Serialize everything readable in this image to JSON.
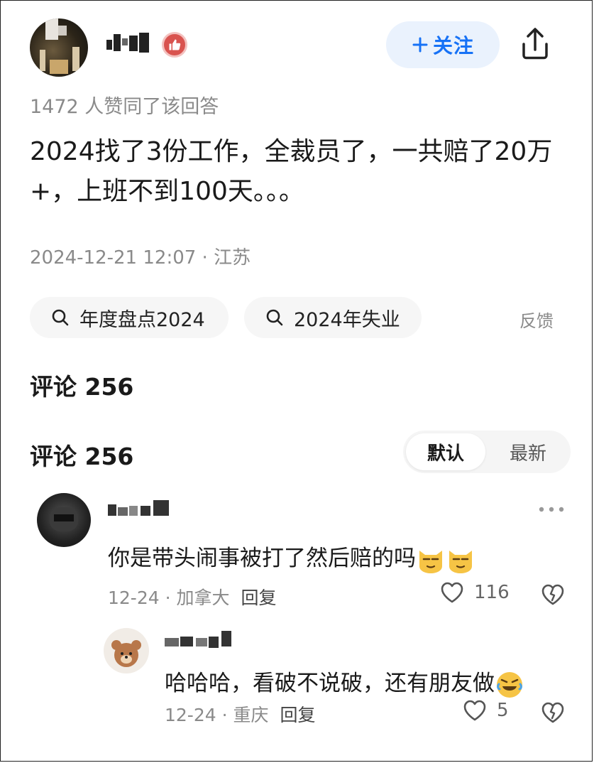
{
  "header": {
    "follow_label": "关注",
    "follow_icon": "plus-icon",
    "share_icon": "share-icon",
    "badge_icon": "thumbs-up-icon"
  },
  "answer": {
    "likes_text": "1472 人赞同了该回答",
    "content": "2024找了3份工作，全裁员了，一共赔了20万+，上班不到100天。。。",
    "meta": "2024-12-21 12:07 · 江苏"
  },
  "tags": [
    {
      "label": "年度盘点2024",
      "icon": "search-icon"
    },
    {
      "label": "2024年失业",
      "icon": "search-icon"
    }
  ],
  "feedback_label": "反馈",
  "comments": {
    "title": "评论 256",
    "sort_options": [
      "默认",
      "最新"
    ],
    "sort_selected": "默认",
    "items": [
      {
        "text": "你是带头闹事被打了然后赔的吗",
        "emoji": [
          "cat-smirk-emoji",
          "cat-smirk-emoji"
        ],
        "date_location": "12-24 · 加拿大",
        "reply_label": "回复",
        "likes": "116"
      },
      {
        "text": "哈哈哈，看破不说破，还有朋友做",
        "emoji": [
          "rofl-emoji"
        ],
        "date_location": "12-24 · 重庆",
        "reply_label": "回复",
        "likes": "5"
      }
    ]
  },
  "colors": {
    "accent": "#1772f6",
    "follow_bg": "#eaf2fd",
    "muted": "#8a8a8a",
    "badge": "#d9534f"
  }
}
